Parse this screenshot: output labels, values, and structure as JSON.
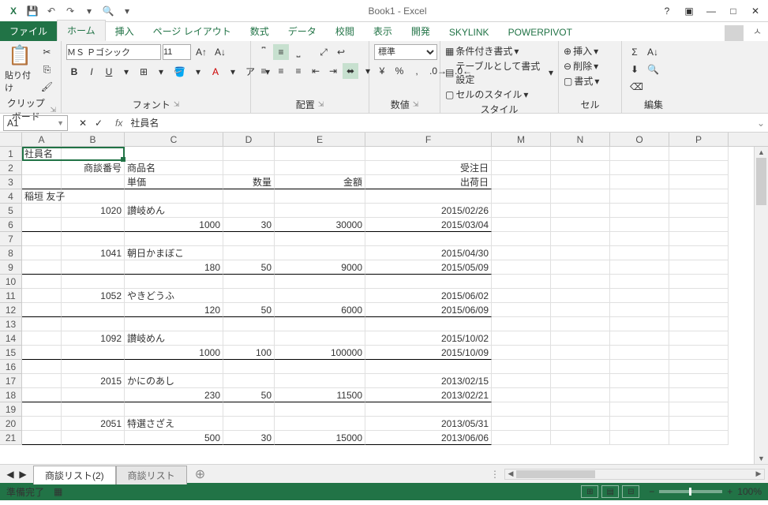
{
  "title": "Book1 - Excel",
  "qat": {
    "save": "💾",
    "undo": "↶",
    "redo": "↷",
    "preview": "🔍"
  },
  "tabs": {
    "file": "ファイル",
    "home": "ホーム",
    "insert": "挿入",
    "pagelayout": "ページ レイアウト",
    "formulas": "数式",
    "data": "データ",
    "review": "校閲",
    "view": "表示",
    "developer": "開発",
    "skylink": "SKYLINK",
    "powerpivot": "POWERPIVOT"
  },
  "ribbon": {
    "clipboard": {
      "label": "クリップボード",
      "paste": "貼り付け"
    },
    "font": {
      "label": "フォント",
      "name": "ＭＳ Ｐゴシック",
      "size": "11"
    },
    "align": {
      "label": "配置"
    },
    "number": {
      "label": "数値",
      "format": "標準"
    },
    "styles": {
      "label": "スタイル",
      "cond": "条件付き書式",
      "table": "テーブルとして書式設定",
      "cell": "セルのスタイル"
    },
    "cells": {
      "label": "セル",
      "insert": "挿入",
      "delete": "削除",
      "format": "書式"
    },
    "editing": {
      "label": "編集"
    }
  },
  "namebox": "A1",
  "formula": "社員名",
  "cols": [
    "A",
    "B",
    "C",
    "D",
    "E",
    "F",
    "M",
    "N",
    "O",
    "P"
  ],
  "rows": [
    {
      "n": 1,
      "A": "社員名"
    },
    {
      "n": 2,
      "B": "商談番号",
      "C": "商品名",
      "F": "受注日"
    },
    {
      "n": 3,
      "C": "単価",
      "D": "数量",
      "E": "金額",
      "F": "出荷日",
      "bb": true
    },
    {
      "n": 4,
      "A": "稲垣 友子"
    },
    {
      "n": 5,
      "B": "1020",
      "C": "讃岐めん",
      "F": "2015/02/26"
    },
    {
      "n": 6,
      "C": "1000",
      "D": "30",
      "E": "30000",
      "F": "2015/03/04",
      "bb": true
    },
    {
      "n": 7
    },
    {
      "n": 8,
      "B": "1041",
      "C": "朝日かまぼこ",
      "F": "2015/04/30"
    },
    {
      "n": 9,
      "C": "180",
      "D": "50",
      "E": "9000",
      "F": "2015/05/09",
      "bb": true
    },
    {
      "n": 10
    },
    {
      "n": 11,
      "B": "1052",
      "C": "やきどうふ",
      "F": "2015/06/02"
    },
    {
      "n": 12,
      "C": "120",
      "D": "50",
      "E": "6000",
      "F": "2015/06/09",
      "bb": true
    },
    {
      "n": 13
    },
    {
      "n": 14,
      "B": "1092",
      "C": "讃岐めん",
      "F": "2015/10/02"
    },
    {
      "n": 15,
      "C": "1000",
      "D": "100",
      "E": "100000",
      "F": "2015/10/09",
      "bb": true
    },
    {
      "n": 16
    },
    {
      "n": 17,
      "B": "2015",
      "C": "かにのあし",
      "F": "2013/02/15"
    },
    {
      "n": 18,
      "C": "230",
      "D": "50",
      "E": "11500",
      "F": "2013/02/21",
      "bb": true
    },
    {
      "n": 19
    },
    {
      "n": 20,
      "B": "2051",
      "C": "特選さざえ",
      "F": "2013/05/31"
    },
    {
      "n": 21,
      "C": "500",
      "D": "30",
      "E": "15000",
      "F": "2013/06/06",
      "bb": true
    }
  ],
  "sheets": {
    "active": "商談リスト(2)",
    "other": "商談リスト"
  },
  "status": {
    "ready": "準備完了",
    "zoom": "100%"
  }
}
